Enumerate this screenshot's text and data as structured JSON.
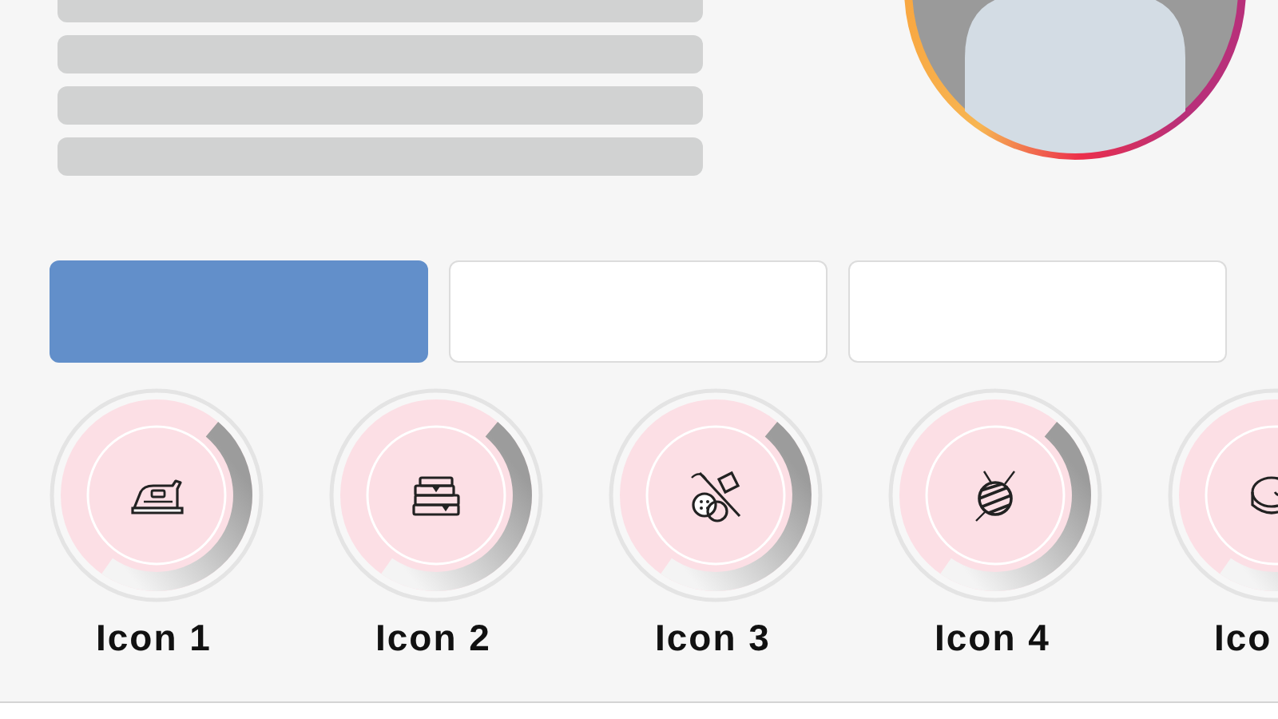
{
  "tabs": [
    {
      "selected": true
    },
    {
      "selected": false
    },
    {
      "selected": false
    }
  ],
  "highlights": [
    {
      "label": "Icon 1"
    },
    {
      "label": "Icon 2"
    },
    {
      "label": "Icon 3"
    },
    {
      "label": "Icon 4"
    },
    {
      "label": "Ico"
    }
  ]
}
